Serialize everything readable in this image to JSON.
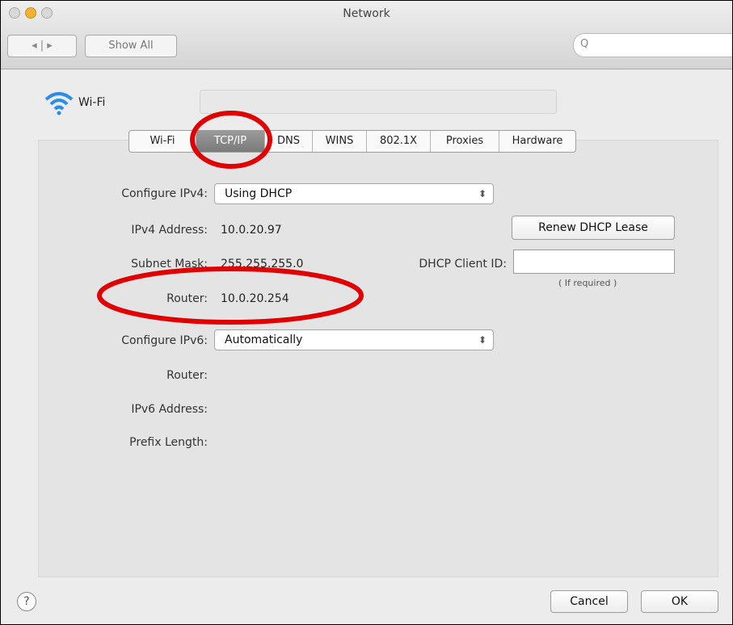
{
  "window": {
    "title": "Network"
  },
  "toolbar": {
    "nav_label": "◂ | ▸",
    "show_all_label": "Show All",
    "search_placeholder": "Q"
  },
  "service": {
    "name": "Wi-Fi"
  },
  "tabs": [
    {
      "label": "Wi-Fi",
      "active": false
    },
    {
      "label": "TCP/IP",
      "active": true
    },
    {
      "label": "DNS",
      "active": false
    },
    {
      "label": "WINS",
      "active": false
    },
    {
      "label": "802.1X",
      "active": false
    },
    {
      "label": "Proxies",
      "active": false
    },
    {
      "label": "Hardware",
      "active": false
    }
  ],
  "ipv4": {
    "configure_label": "Configure IPv4:",
    "configure_value": "Using DHCP",
    "address_label": "IPv4 Address:",
    "address_value": "10.0.20.97",
    "subnet_label": "Subnet Mask:",
    "subnet_value": "255.255.255.0",
    "router_label": "Router:",
    "router_value": "10.0.20.254",
    "renew_button": "Renew DHCP Lease",
    "client_id_label": "DHCP Client ID:",
    "client_id_value": "",
    "client_id_hint": "( If required )"
  },
  "ipv6": {
    "configure_label": "Configure IPv6:",
    "configure_value": "Automatically",
    "router_label": "Router:",
    "address_label": "IPv6 Address:",
    "prefix_label": "Prefix Length:"
  },
  "footer": {
    "help_label": "?",
    "cancel_label": "Cancel",
    "ok_label": "OK"
  },
  "colors": {
    "annotation": "#e00000",
    "active_tab": "#8a8a8a"
  },
  "icons": {
    "wifi": "wifi-icon",
    "help": "help-icon",
    "search": "search-icon"
  }
}
